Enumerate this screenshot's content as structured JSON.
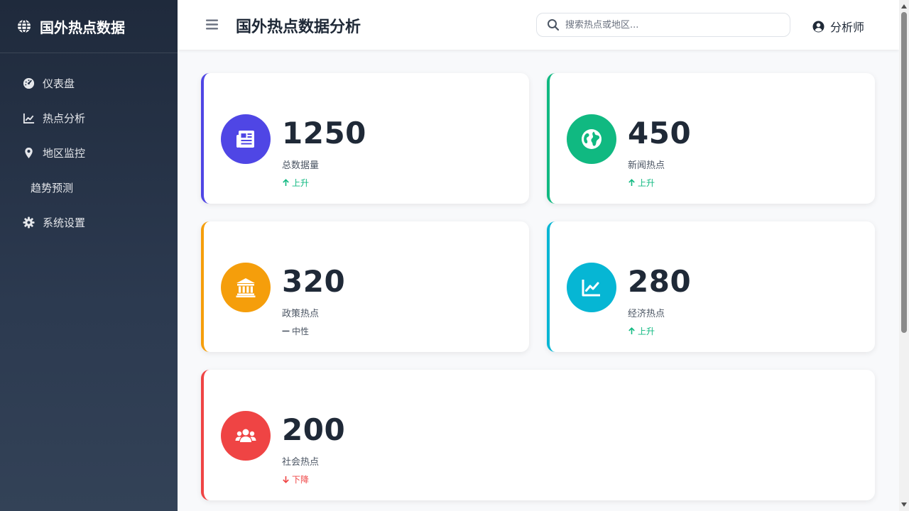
{
  "sidebar": {
    "brand": "国外热点数据",
    "items": [
      {
        "label": "仪表盘"
      },
      {
        "label": "热点分析"
      },
      {
        "label": "地区监控"
      },
      {
        "label": "趋势预测"
      },
      {
        "label": "系统设置"
      }
    ]
  },
  "header": {
    "title": "国外热点数据分析",
    "search_placeholder": "搜索热点或地区...",
    "user_label": "分析师"
  },
  "cards": [
    {
      "value": "1250",
      "label": "总数据量",
      "trend": "上升",
      "trend_dir": "up",
      "color": "#4f46e5",
      "icon": "newspaper-icon"
    },
    {
      "value": "450",
      "label": "新闻热点",
      "trend": "上升",
      "trend_dir": "up",
      "color": "#10b981",
      "icon": "globe-icon"
    },
    {
      "value": "320",
      "label": "政策热点",
      "trend": "中性",
      "trend_dir": "neutral",
      "color": "#f59e0b",
      "icon": "landmark-icon"
    },
    {
      "value": "280",
      "label": "经济热点",
      "trend": "上升",
      "trend_dir": "up",
      "color": "#06b6d4",
      "icon": "chart-line-icon"
    },
    {
      "value": "200",
      "label": "社会热点",
      "trend": "下降",
      "trend_dir": "down",
      "color": "#ef4444",
      "icon": "users-icon"
    }
  ],
  "colors": {
    "trend_up": "#10b981",
    "trend_down": "#ef4444",
    "trend_neutral": "#4b5563"
  }
}
